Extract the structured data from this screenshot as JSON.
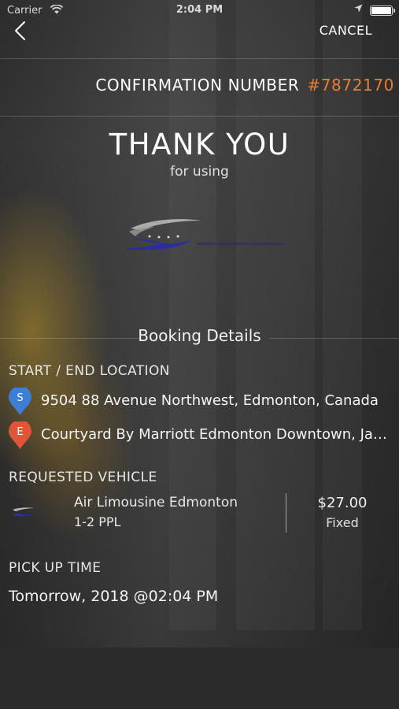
{
  "status_bar": {
    "carrier": "Carrier",
    "time": "2:04 PM",
    "battery_level": 1.0
  },
  "nav": {
    "cancel_label": "CANCEL"
  },
  "confirmation": {
    "label": "CONFIRMATION NUMBER",
    "number": "#7872170"
  },
  "thanks": {
    "title": "THANK YOU",
    "subtitle": "for using"
  },
  "booking": {
    "section_title": "Booking Details",
    "location_label": "START / END LOCATION",
    "start": {
      "marker": "S",
      "address": "9504 88 Avenue Northwest, Edmonton, Canada",
      "color": "#3d7fd6"
    },
    "end": {
      "marker": "E",
      "address": "Courtyard By Marriott Edmonton Downtown, Jasper Avenue",
      "color": "#e0553a"
    },
    "vehicle_label": "REQUESTED VEHICLE",
    "vehicle": {
      "name": "Air Limousine Edmonton",
      "capacity": "1-2 PPL",
      "price": "$27.00",
      "price_type": "Fixed"
    },
    "pickup_label": "PICK UP TIME",
    "pickup_time": "Tomorrow, 2018 @02:04 PM"
  },
  "colors": {
    "accent": "#f07a2e"
  }
}
